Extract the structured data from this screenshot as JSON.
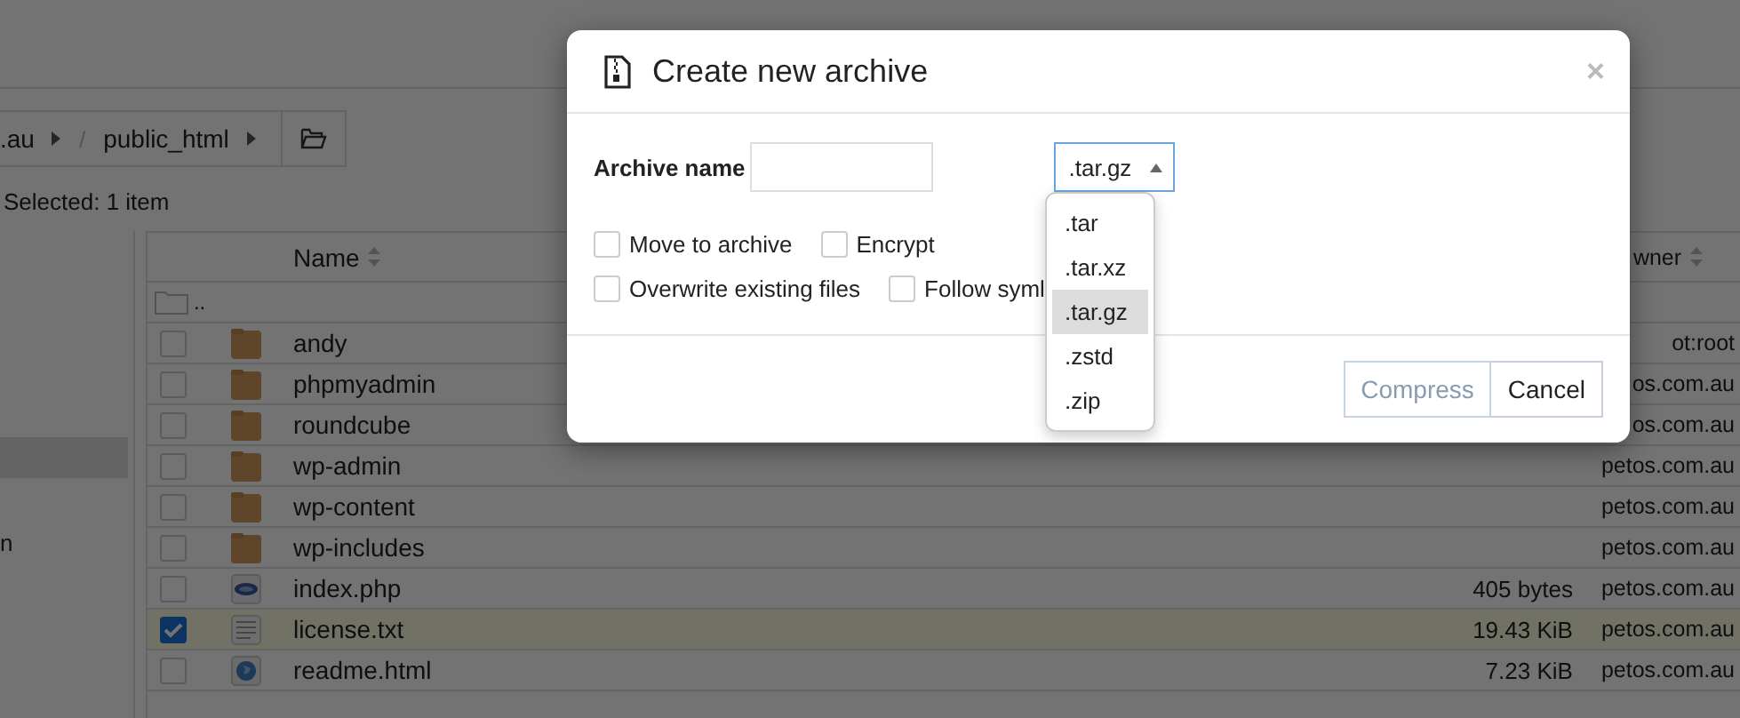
{
  "breadcrumb": {
    "items": [
      ".au",
      "public_html"
    ],
    "separator": "/"
  },
  "selection_status": "Selected: 1 item",
  "sidebar": {
    "items": [
      {
        "selected": true
      },
      {
        "label": "n",
        "selected": false
      }
    ]
  },
  "table": {
    "columns": [
      "Name",
      "wner"
    ],
    "parent_row": "..",
    "rows": [
      {
        "name": "andy",
        "kind": "folder",
        "checked": false,
        "owner": "ot:root"
      },
      {
        "name": "phpmyadmin",
        "kind": "folder",
        "checked": false,
        "owner": "os.com.au"
      },
      {
        "name": "roundcube",
        "kind": "folder",
        "checked": false,
        "owner": "os.com.au"
      },
      {
        "name": "wp-admin",
        "kind": "folder",
        "checked": false,
        "owner": "petos.com.au"
      },
      {
        "name": "wp-content",
        "kind": "folder",
        "checked": false,
        "owner": "petos.com.au"
      },
      {
        "name": "wp-includes",
        "kind": "folder",
        "checked": false,
        "owner": "petos.com.au"
      },
      {
        "name": "index.php",
        "kind": "php",
        "checked": false,
        "size": "405 bytes",
        "owner": "petos.com.au"
      },
      {
        "name": "license.txt",
        "kind": "text",
        "checked": true,
        "size": "19.43 KiB",
        "owner": "petos.com.au"
      },
      {
        "name": "readme.html",
        "kind": "html",
        "checked": false,
        "size": "7.23 KiB",
        "owner": "petos.com.au"
      }
    ]
  },
  "dialog": {
    "title": "Create new archive",
    "close": "×",
    "archive_name_label": "Archive name",
    "format_select": {
      "value": ".tar.gz",
      "expanded": true,
      "options": [
        {
          "label": ".tar",
          "selected": false
        },
        {
          "label": ".tar.xz",
          "selected": false
        },
        {
          "label": ".tar.gz",
          "selected": true
        },
        {
          "label": ".zstd",
          "selected": false
        },
        {
          "label": ".zip",
          "selected": false
        }
      ]
    },
    "option_rows": [
      [
        {
          "label": "Move to archive",
          "checked": false
        },
        {
          "label": "Encrypt",
          "checked": false
        }
      ],
      [
        {
          "label": "Overwrite existing files",
          "checked": false
        },
        {
          "label": "Follow syml",
          "checked": false
        }
      ]
    ],
    "buttons": [
      {
        "label": "Compress",
        "disabled": true
      },
      {
        "label": "Cancel",
        "disabled": false
      }
    ]
  }
}
